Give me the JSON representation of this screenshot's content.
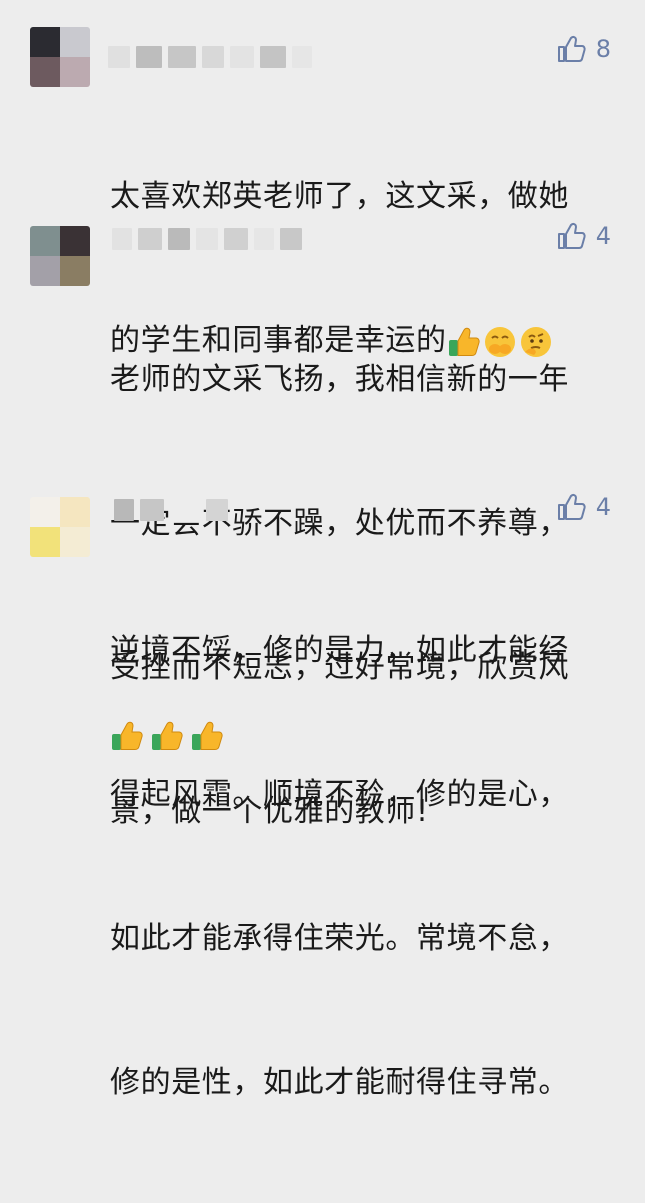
{
  "comments": [
    {
      "likes": "8",
      "text": "太喜欢郑英老师了，这文采，做她的学生和同事都是幸运的",
      "line1": "太喜欢郑英老师了，这文采，做她",
      "line2": "的学生和同事都是幸运的",
      "emojis": [
        "thumbs-up-icon",
        "covering-mouth-face-icon",
        "thinking-face-icon"
      ]
    },
    {
      "likes": "4",
      "line1": "老师的文采飞扬，我相信新的一年",
      "line2": "一定会不骄不躁，处优而不养尊，",
      "line3": "受挫而不短志，过好常境，欣赏风",
      "line4": "景，做一个优雅的教师!"
    },
    {
      "likes": "4",
      "line1": "逆境不馁，修的是力，如此才能经",
      "line2": "得起风霜。顺境不矜，修的是心，",
      "line3": "如此才能承得住荣光。常境不怠，",
      "line4": "修的是性，如此才能耐得住寻常。",
      "emojis": [
        "thumbs-up-icon",
        "thumbs-up-icon",
        "thumbs-up-icon"
      ]
    }
  ],
  "colors": {
    "background": "#ededed",
    "like_blue": "#6b7fa8",
    "text": "#1a1a1a"
  }
}
